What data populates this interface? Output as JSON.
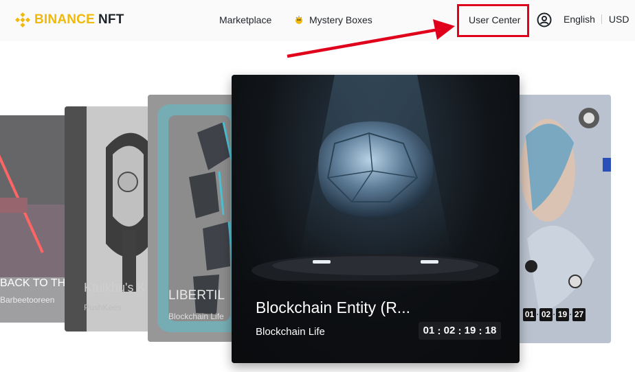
{
  "header": {
    "logo": {
      "brand": "BINANCE",
      "product": "NFT"
    },
    "nav": {
      "marketplace": "Marketplace",
      "mystery_boxes": "Mystery Boxes",
      "user_center": "User Center",
      "language": "English",
      "currency": "USD"
    }
  },
  "icons": {
    "logo": "binance-diamond-icon",
    "mystery": "mystery-box-icon",
    "account": "account-circle-icon"
  },
  "colors": {
    "brand_yellow": "#F0B90B",
    "annotation_red": "#e0001b",
    "text_dark": "#1E2329"
  },
  "carousel": {
    "cards": [
      {
        "title": "BACK TO TH",
        "creator": "Barbeetooreen"
      },
      {
        "title": "Ktulkhu's K",
        "creator": "PushKees"
      },
      {
        "title": "LIBERTIL",
        "creator": "Blockchain Life"
      },
      {
        "title": "Blockchain Entity (R...",
        "creator": "Blockchain Life",
        "countdown": {
          "days": "01",
          "hours": "02",
          "minutes": "19",
          "seconds": "18"
        }
      },
      {
        "countdown": {
          "days": "01",
          "hours": "02",
          "minutes": "19",
          "seconds": "27"
        }
      }
    ]
  }
}
